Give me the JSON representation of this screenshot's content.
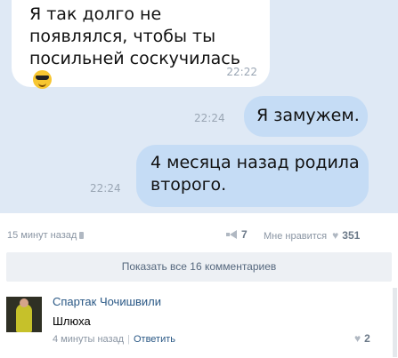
{
  "messages": [
    {
      "direction": "in",
      "text": "Я так долго не появлялся, чтобы ты посильней соскучилась",
      "emoji": "sunglasses-emoji",
      "time": "22:22"
    },
    {
      "direction": "out",
      "text": "Я замужем.",
      "time": "22:24"
    },
    {
      "direction": "out",
      "text": "4 месяца назад родила второго.",
      "time": "22:24"
    }
  ],
  "post_meta": {
    "posted": "15 минут назад",
    "reposts": "7",
    "likes_label": "Мне нравится",
    "likes": "351"
  },
  "show_all_label": "Показать все 16 комментариев",
  "comment": {
    "author": "Спартак Чочишвили",
    "text": "Шлюха",
    "time": "4 минуты назад",
    "reply_label": "Ответить",
    "likes": "2"
  },
  "colors": {
    "chat_bg": "#dfe9f5",
    "out_bubble": "#c5dcf5",
    "link": "#2a5885"
  }
}
